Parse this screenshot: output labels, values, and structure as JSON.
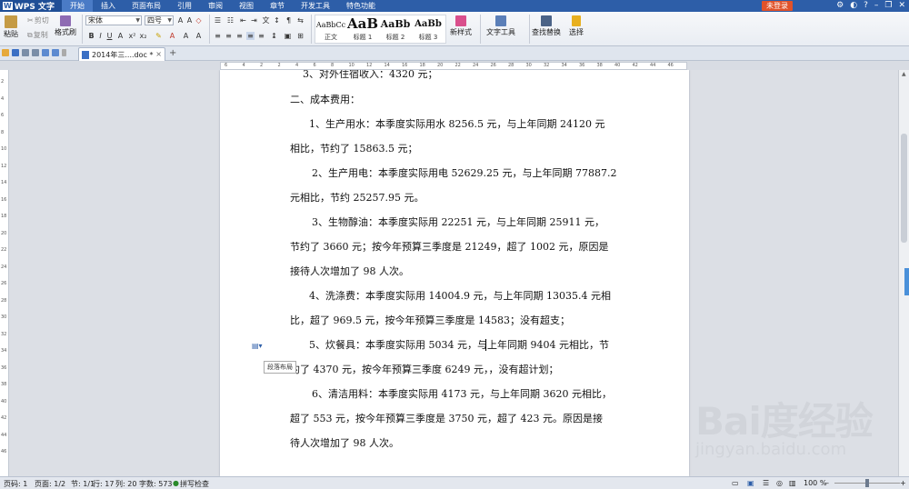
{
  "app": {
    "logo_text": "WPS 文字"
  },
  "menu": {
    "items": [
      "开始",
      "插入",
      "页面布局",
      "引用",
      "审阅",
      "视图",
      "章节",
      "开发工具",
      "特色功能"
    ],
    "login": "未登录"
  },
  "ribbon": {
    "paste": "粘贴",
    "cut": "剪切",
    "copy": "复制",
    "format_painter": "格式刷",
    "font_name": "宋体",
    "font_size": "四号",
    "styles": [
      {
        "sample": "AaBbCc",
        "label": "正文"
      },
      {
        "sample": "AaB",
        "label": "标题 1"
      },
      {
        "sample": "AaBb",
        "label": "标题 2"
      },
      {
        "sample": "AaBb",
        "label": "标题 3"
      }
    ],
    "new_style": "新样式",
    "text_tools": "文字工具",
    "find_replace": "查找替换",
    "select": "选择",
    "bold": "B",
    "italic": "I",
    "underline": "U",
    "superscript": "x²",
    "subscript": "x₂"
  },
  "tabs": {
    "doc_title": "2014年三....doc *"
  },
  "document": {
    "paragraphs": [
      "3、对外住宿收入：4320 元；",
      "二、成本费用：",
      "1、生产用水：本季度实际用水 8256.5 元，与上年同期 24120 元",
      "相比，节约了 15863.5 元；",
      "2、生产用电：本季度实际用电 52629.25 元，与上年同期 77887.2",
      "元相比，节约 25257.95 元。",
      "3、生物醇油：本季度实际用 22251 元，与上年同期 25911 元，",
      "节约了 3660 元；按今年预算三季度是 21249，超了 1002 元，原因是",
      "接待人次增加了 98 人次。",
      "4、洗涤费：本季度实际用 14004.9 元，与上年同期 13035.4 元相",
      "比，超了 969.5 元，按今年预算三季度是 14583；没有超支；",
      "5、炊餐具：本季度实际用 5034 元，与上年同期 9404 元相比，节",
      "约了 4370 元，按今年预算三季度 6249 元，，没有超计划；",
      "6、清洁用料：本季度实际用 4173 元，与上年同期 3620 元相比，",
      "超了 553 元，按今年预算三季度是 3750 元，超了 423 元。原因是接",
      "待人次增加了 98 人次。"
    ],
    "tooltip": "段落布局"
  },
  "watermark": {
    "brand": "Bai度经验",
    "url": "jingyan.baidu.com"
  },
  "status": {
    "page_num": "页码: 1",
    "pages": "页面: 1/2",
    "section": "节: 1/1",
    "row": "行: 17",
    "col": "列: 20",
    "word_count": "字数: 573",
    "spell_check": "拼写检查",
    "zoom": "100 %"
  },
  "ruler": {
    "h_numbers": [
      "6",
      "4",
      "2",
      "2",
      "4",
      "6",
      "8",
      "10",
      "12",
      "14",
      "16",
      "18",
      "20",
      "22",
      "24",
      "26",
      "28",
      "30",
      "32",
      "34",
      "36",
      "38",
      "40",
      "42",
      "44",
      "46"
    ],
    "v_numbers": [
      "2",
      "4",
      "6",
      "8",
      "10",
      "12",
      "14",
      "16",
      "18",
      "20",
      "22",
      "24",
      "26",
      "28",
      "30",
      "32",
      "34",
      "36",
      "38",
      "40",
      "42",
      "44",
      "46"
    ]
  },
  "colors": {
    "accent": "#2d5ea8",
    "login": "#e0522a"
  }
}
